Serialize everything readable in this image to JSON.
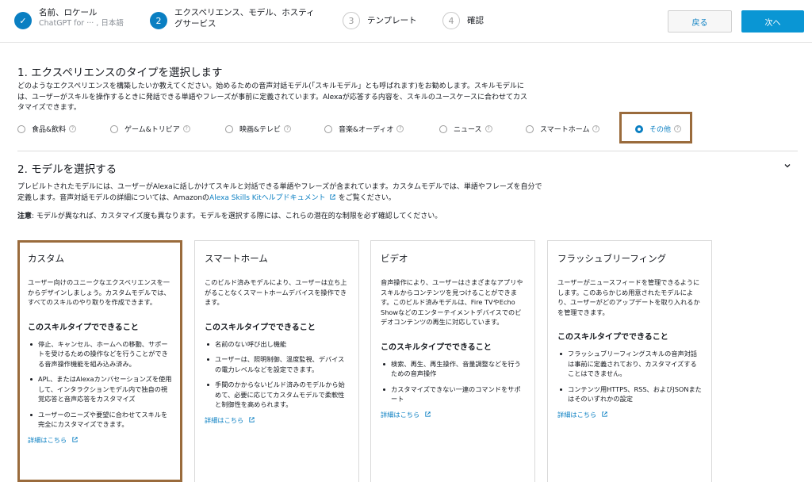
{
  "stepper": {
    "steps": [
      {
        "number": "✓",
        "title": "名前、ロケール",
        "sub": "ChatGPT for ··· , 日本語",
        "state": "done"
      },
      {
        "number": "2",
        "title": "エクスペリエンス、モデル、ホスティ",
        "title2": "グサービス",
        "state": "current"
      },
      {
        "number": "3",
        "title": "テンプレート",
        "state": "todo"
      },
      {
        "number": "4",
        "title": "確認",
        "state": "todo"
      }
    ],
    "back_label": "戻る",
    "next_label": "次へ"
  },
  "section1": {
    "title": "1. エクスペリエンスのタイプを選択します",
    "desc_line1": "どのようなエクスペリエンスを構築したいか教えてください。始めるための音声対話モデル(「スキルモデル」とも呼ばれます)をお勧めします。スキルモデルに",
    "desc_line2": "は、ユーザーがスキルを操作するときに発話できる単語やフレーズが事前に定義されています。Alexaが応答する内容を、スキルのユースケースに合わせてカス",
    "desc_line3": "タマイズできます。",
    "options": [
      {
        "label": "食品&飲料",
        "selected": false
      },
      {
        "label": "ゲーム&トリビア",
        "selected": false
      },
      {
        "label": "映画&テレビ",
        "selected": false
      },
      {
        "label": "音楽&オーディオ",
        "selected": false
      },
      {
        "label": "ニュース",
        "selected": false
      },
      {
        "label": "スマートホーム",
        "selected": false
      },
      {
        "label": "その他",
        "selected": true
      }
    ],
    "help_glyph": "?"
  },
  "section2": {
    "title": "2. モデルを選択する",
    "desc_line1": "プレビルトされたモデルには、ユーザーがAlexaに話しかけてスキルと対話できる単語やフレーズが含まれています。カスタムモデルでは、単語やフレーズを自分で",
    "desc_line2a": "定義します。音声対話モデルの詳細については、Amazonの",
    "desc_link": "Alexa Skills Kitヘルプドキュメント",
    "desc_line2b": "をご覧ください。",
    "note_label": "注意",
    "note_text": ": モデルが異なれば、カスタマイズ度も異なります。モデルを選択する際には、これらの潜在的な制限を必ず確認してください。"
  },
  "cards": [
    {
      "title": "カスタム",
      "desc": "ユーザー向けのユニークなエクスペリエンスを一からデザインしましょう。カスタムモデルでは、すべてのスキルのやり取りを作成できます。",
      "sub": "このスキルタイプでできること",
      "items": [
        "停止、キャンセル、ホームへの移動、サポートを受けるための操作などを行うことができる音声操作機能を組み込み済み。",
        "APL、またはAlexaカンバセーションズを使用して、インタラクションモデル内で独自の視覚応答と音声応答をカスタマイズ",
        "ユーザーのニーズや要望に合わせてスキルを完全にカスタマイズできます。"
      ],
      "link": "詳細はこちら"
    },
    {
      "title": "スマートホーム",
      "desc": "このビルド済みモデルにより、ユーザーは立ち上がることなくスマートホームデバイスを操作できます。",
      "sub": "このスキルタイプでできること",
      "items": [
        "名前のない呼び出し機能",
        "ユーザーは、照明制御、温度監視、デバイスの電力レベルなどを設定できます。",
        "手間のかからないビルド済みのモデルから始めて、必要に応じてカスタムモデルで柔軟性と制御性を高められます。"
      ],
      "link": "詳細はこちら"
    },
    {
      "title": "ビデオ",
      "desc": "音声操作により、ユーザーはさまざまなアプリやスキルからコンテンツを見つけることができます。このビルド済みモデルは、Fire TVやEcho Showなどのエンターテイメントデバイスでのビデオコンテンツの再生に対応しています。",
      "sub": "このスキルタイプでできること",
      "items": [
        "検索、再生、再生操作、音量調整などを行うための音声操作",
        "カスタマイズできない一連のコマンドをサポート"
      ],
      "link": "詳細はこちら"
    },
    {
      "title": "フラッシュブリーフィング",
      "desc": "ユーザーがニュースフィードを管理できるようにします。このあらかじめ用意されたモデルにより、ユーザーがどのアップデートを取り入れるかを管理できます。",
      "sub": "このスキルタイプでできること",
      "items": [
        "フラッシュブリーフィングスキルの音声対話は事前に定義されており、カスタマイズすることはできません。",
        "コンテンツ用HTTPS、RSS、およびJSONまたはそのいずれかの設定"
      ],
      "link": "詳細はこちら"
    }
  ],
  "colors": {
    "accent": "#0a7fc2",
    "highlight": "#9a6b3c",
    "primary_button": "#0a96d4"
  }
}
